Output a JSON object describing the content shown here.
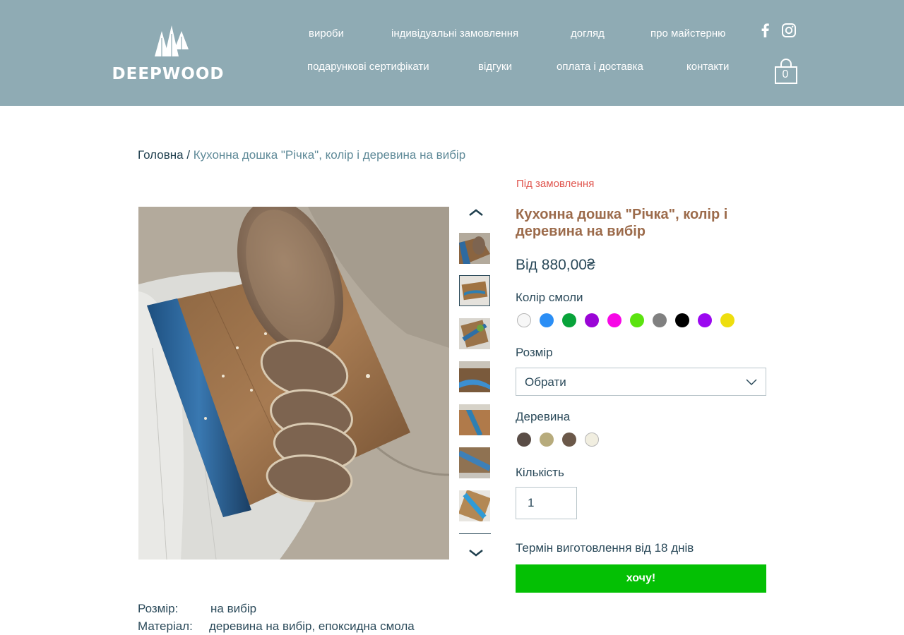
{
  "brand": {
    "name": "DEEPWOOD"
  },
  "nav": {
    "row1": [
      "вироби",
      "індивідуальні замовлення",
      "догляд",
      "про майстерню"
    ],
    "row2": [
      "подарункові сертифікати",
      "відгуки",
      "оплата і доставка",
      "контакти"
    ]
  },
  "social": {
    "facebook_icon": "facebook-icon",
    "instagram_icon": "instagram-icon"
  },
  "cart": {
    "count": "0",
    "icon": "shopping-bag-icon"
  },
  "breadcrumb": {
    "home": "Головна",
    "separator": " / ",
    "current": "Кухонна дошка \"Річка\", колір і деревина на вибір"
  },
  "product": {
    "availability": "Під замовлення",
    "title": "Кухонна дошка \"Річка\", колір і деревина на вибір",
    "price": "Від 880,00₴",
    "resin_color_label": "Колір смоли",
    "resin_colors": [
      "#f7f7f7",
      "#2b8ef5",
      "#08a33a",
      "#9a05d6",
      "#f708e6",
      "#5be30f",
      "#808080",
      "#000000",
      "#9b08f0",
      "#eede0e"
    ],
    "size_label": "Розмір",
    "size_select_value": "Обрати",
    "wood_label": "Деревина",
    "wood_colors": [
      "#5a4d46",
      "#b7ab7c",
      "#6b5849",
      "#f1eee0"
    ],
    "quantity_label": "Кількість",
    "quantity_value": "1",
    "lead_time": "Термін виготовлення від 18 днів",
    "buy_button": "хочу!",
    "accent_color": "#04c004"
  },
  "gallery": {
    "thumbnail_count": 7,
    "selected_index": 1
  },
  "specs": [
    {
      "key": "Розмір:",
      "value": "на вибір"
    },
    {
      "key": "Матеріал:",
      "value": "деревина на вибір, епоксидна смола"
    }
  ]
}
